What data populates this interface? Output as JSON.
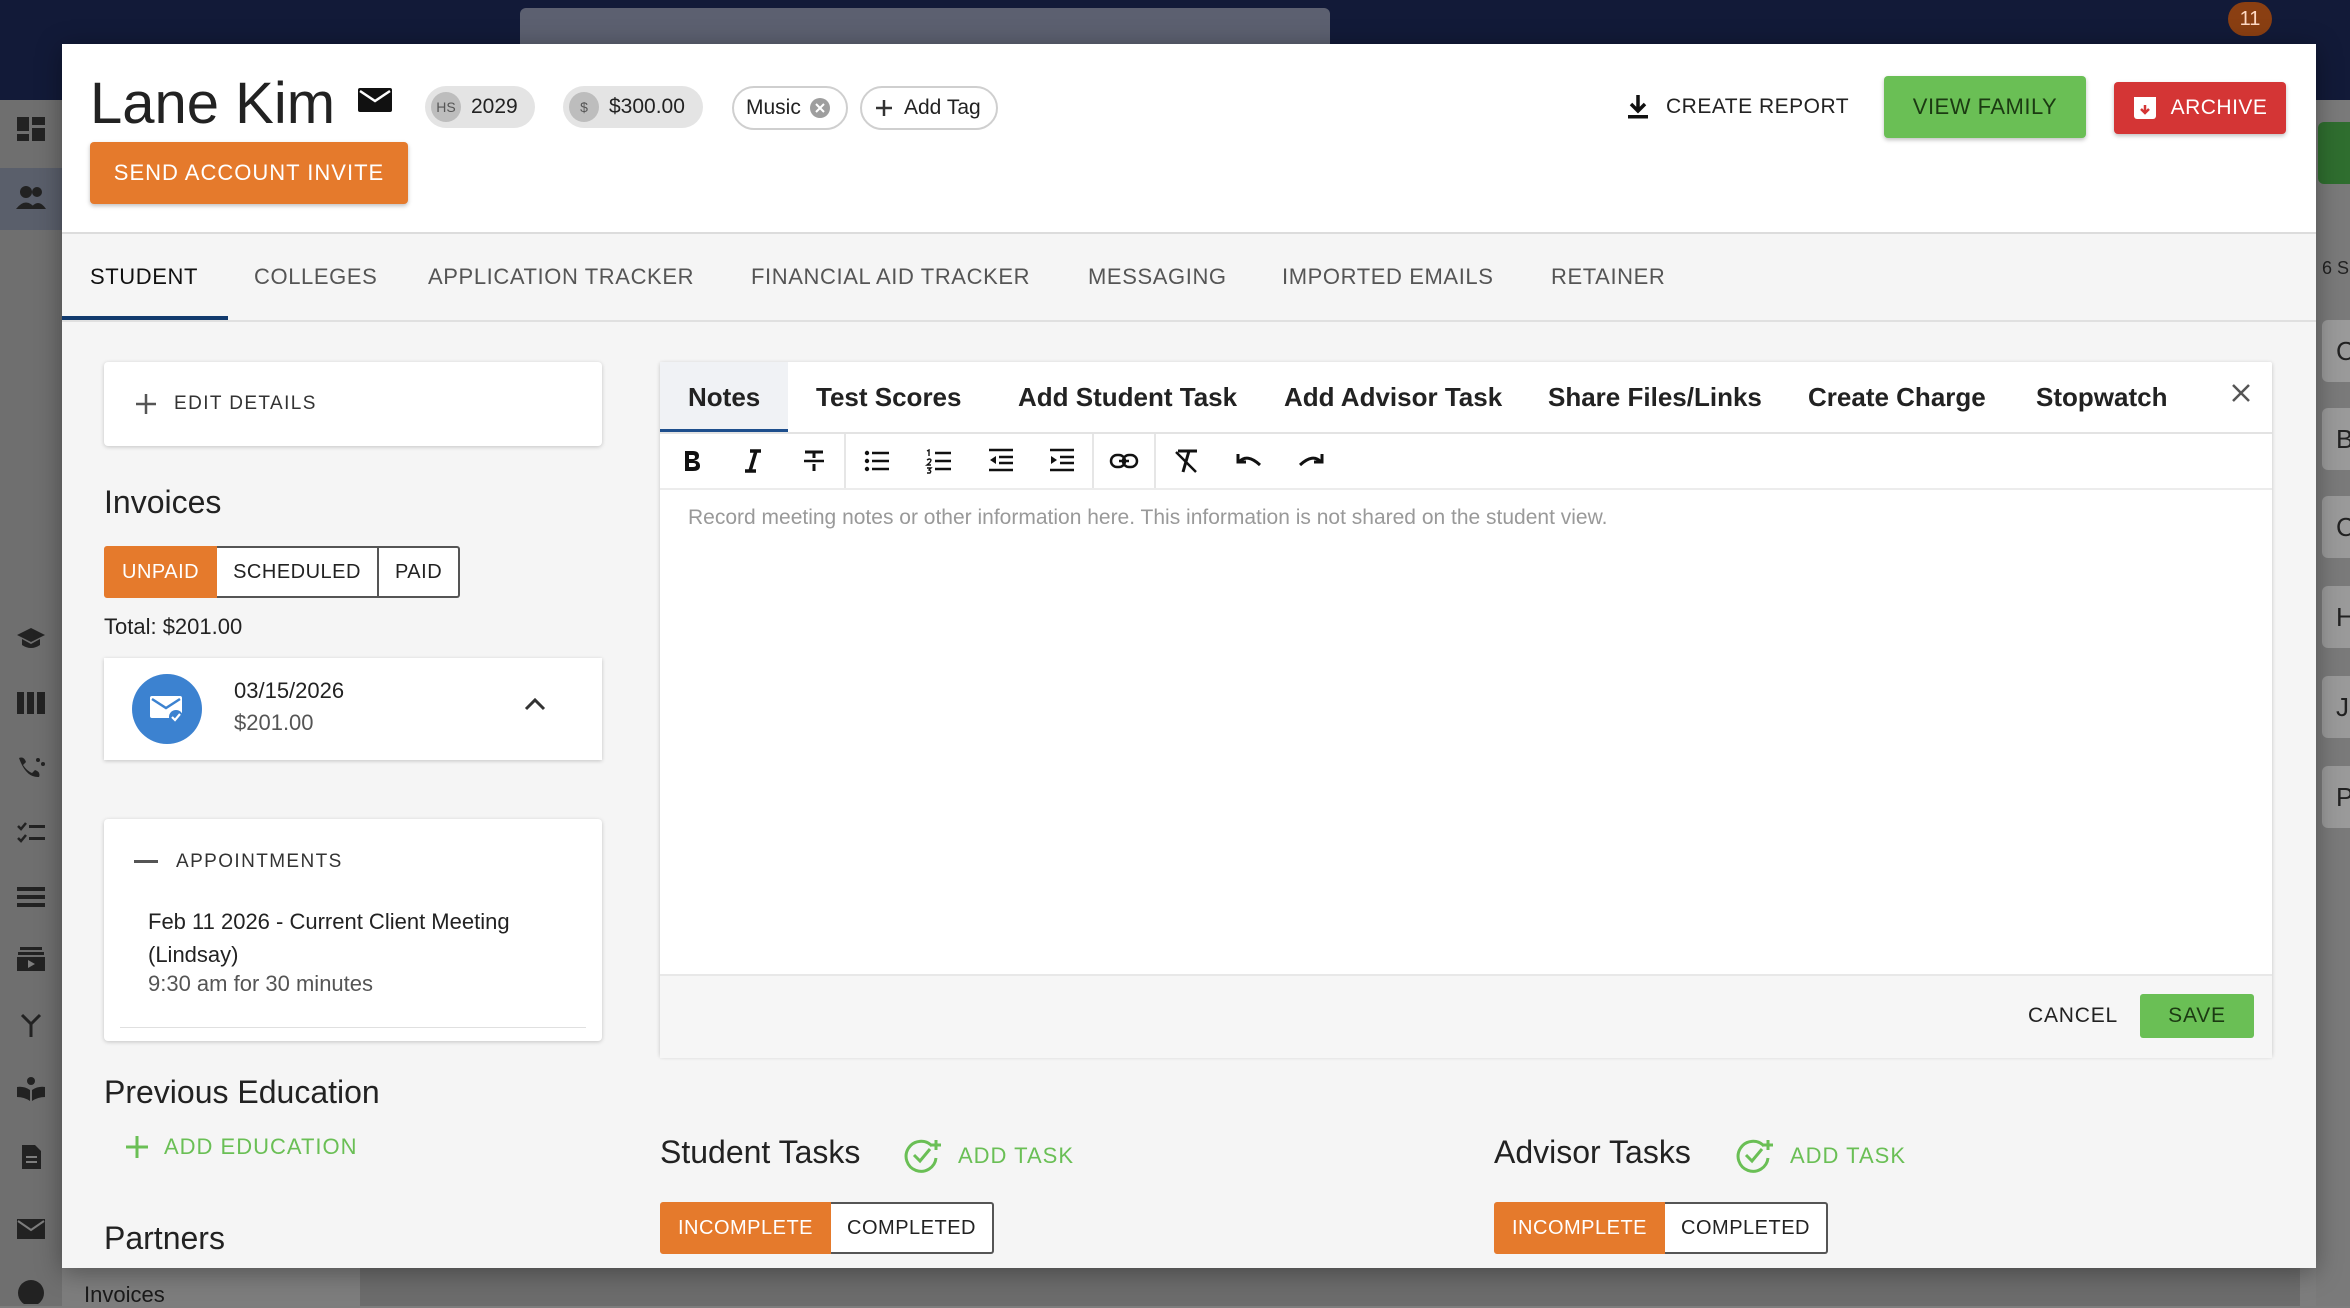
{
  "background": {
    "notification_count": "11",
    "sidebar_bottom_label": "Invoices",
    "right_edge_letters": [
      "C",
      "B",
      "C",
      "H",
      "J",
      "P"
    ],
    "right_edge_label": "6 S"
  },
  "header": {
    "student_name": "Lane Kim",
    "grad_badge": "HS",
    "grad_year": "2029",
    "balance_badge": "$",
    "balance": "$300.00",
    "tags": [
      "Music"
    ],
    "add_tag_label": "Add Tag",
    "send_invite_label": "SEND ACCOUNT INVITE",
    "create_report_label": "CREATE REPORT",
    "view_family_label": "VIEW FAMILY",
    "archive_label": "ARCHIVE"
  },
  "tabs": [
    "STUDENT",
    "COLLEGES",
    "APPLICATION TRACKER",
    "FINANCIAL AID TRACKER",
    "MESSAGING",
    "IMPORTED EMAILS",
    "RETAINER"
  ],
  "active_tab": "STUDENT",
  "left": {
    "edit_details_label": "EDIT DETAILS",
    "invoices_heading": "Invoices",
    "invoice_filters": [
      "UNPAID",
      "SCHEDULED",
      "PAID"
    ],
    "invoice_filter_active": "UNPAID",
    "total_label": "Total: $201.00",
    "invoice": {
      "date": "03/15/2026",
      "amount": "$201.00"
    },
    "appointments_label": "APPOINTMENTS",
    "appointment": {
      "title": "Feb 11 2026 - Current Client Meeting (Lindsay)",
      "time": "9:30 am for 30 minutes"
    },
    "previous_education_heading": "Previous Education",
    "add_education_label": "ADD EDUCATION",
    "partners_heading": "Partners"
  },
  "notes_panel": {
    "tabs": [
      "Notes",
      "Test Scores",
      "Add Student Task",
      "Add Advisor Task",
      "Share Files/Links",
      "Create Charge",
      "Stopwatch"
    ],
    "active_tab": "Notes",
    "toolbar": [
      "bold",
      "italic",
      "strikethrough",
      "bullet-list",
      "numbered-list",
      "outdent",
      "indent",
      "link",
      "clear-format",
      "undo",
      "redo"
    ],
    "placeholder": "Record meeting notes or other information here. This information is not shared on the student view.",
    "cancel_label": "CANCEL",
    "save_label": "SAVE"
  },
  "tasks": {
    "student_heading": "Student Tasks",
    "advisor_heading": "Advisor Tasks",
    "add_task_label": "ADD TASK",
    "filters": [
      "INCOMPLETE",
      "COMPLETED"
    ],
    "filter_active": "INCOMPLETE"
  },
  "colors": {
    "accent_orange": "#e57a2c",
    "green": "#6abf55",
    "red": "#d43535",
    "nav_dark": "#121a38",
    "invoice_blue": "#3c82d0"
  }
}
